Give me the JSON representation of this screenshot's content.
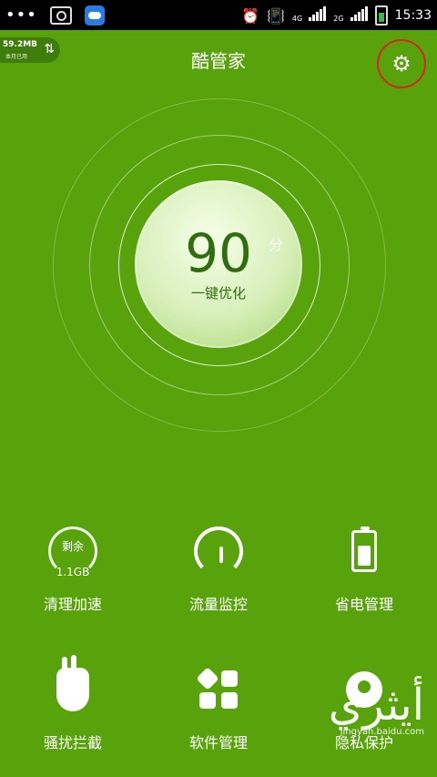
{
  "status_bar": {
    "dots": "•••",
    "time": "15:33",
    "network_labels": [
      "4G",
      "2G"
    ]
  },
  "header": {
    "title": "酷管家",
    "data_usage": {
      "amount": "59.2MB",
      "subtitle": "本月已用",
      "arrows": "⇅"
    }
  },
  "score": {
    "value": "90",
    "unit": "分",
    "action_label": "一键优化"
  },
  "tiles": [
    {
      "label": "清理加速",
      "gauge_top": "剩余",
      "gauge_bottom": "1.1GB"
    },
    {
      "label": "流量监控"
    },
    {
      "label": "省电管理"
    },
    {
      "label": "骚扰拦截"
    },
    {
      "label": "软件管理"
    },
    {
      "label": "隐私保护"
    }
  ],
  "watermark": {
    "logo_text": "أيثري",
    "site": "jingyan.baidu.com"
  },
  "colors": {
    "accent": "#58a30c",
    "settings_highlight": "#d8261d",
    "statusbar": "#000000"
  }
}
